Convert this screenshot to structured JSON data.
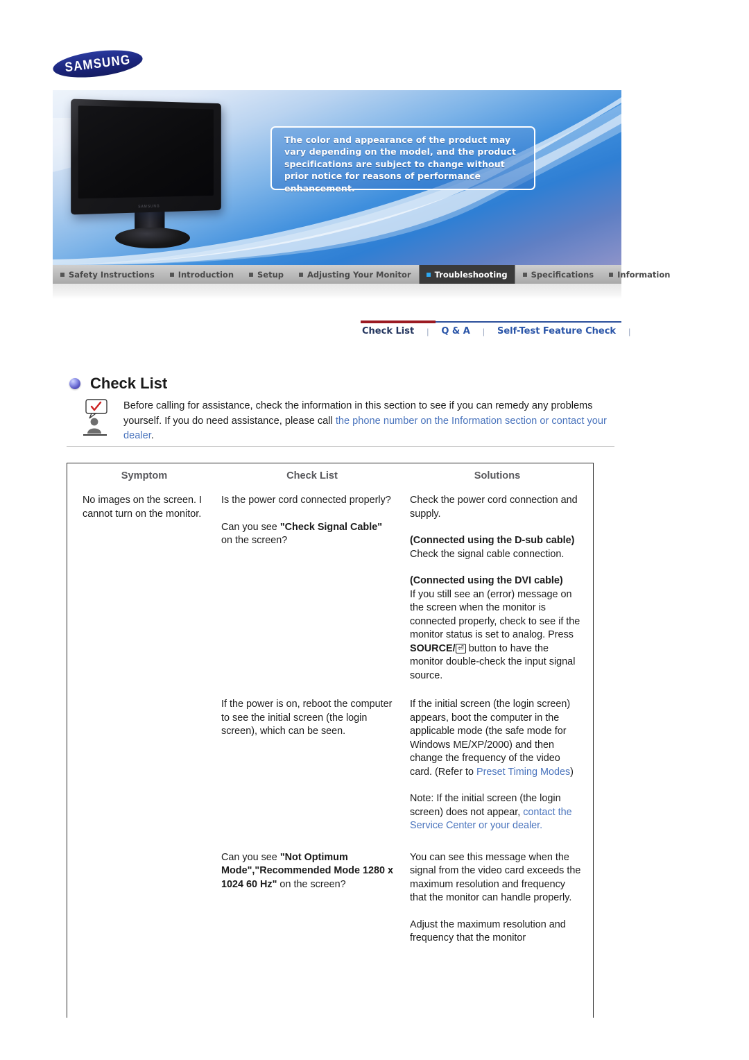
{
  "brand": {
    "logo_text": "SAMSUNG"
  },
  "hero": {
    "notice": "The color and appearance of the product may vary depending on the model, and the product specifications are subject to change without prior notice for reasons of performance enhancement.",
    "monitor_brand_label": "SAMSUNG"
  },
  "main_nav": {
    "items": [
      {
        "label": "Safety Instructions",
        "active": false
      },
      {
        "label": "Introduction",
        "active": false
      },
      {
        "label": "Setup",
        "active": false
      },
      {
        "label": "Adjusting Your Monitor",
        "active": false
      },
      {
        "label": "Troubleshooting",
        "active": true
      },
      {
        "label": "Specifications",
        "active": false
      },
      {
        "label": "Information",
        "active": false
      }
    ]
  },
  "sub_nav": {
    "items": [
      {
        "label": "Check List",
        "active": true
      },
      {
        "label": "Q & A",
        "active": false
      },
      {
        "label": "Self-Test Feature Check",
        "active": false
      }
    ],
    "separator": "|"
  },
  "section": {
    "title": "Check List",
    "intro_1": "Before calling for assistance, check the information in this section to see if you can remedy any problems yourself. If you do need assistance, please call ",
    "intro_link": "the phone number on the Information section or contact your dealer",
    "intro_end": "."
  },
  "table": {
    "headers": [
      "Symptom",
      "Check List",
      "Solutions"
    ],
    "rows": [
      {
        "symptom": "No images on the screen. I cannot turn on the monitor.",
        "checks": [
          {
            "text": "Is the power cord connected properly?"
          },
          {
            "bold": "Can you see \"Check Signal Cable\" on the screen?",
            "lead": "Can you see ",
            "strong": "\"Check Signal Cable\"",
            "tail": " on the screen?"
          }
        ],
        "solutions": [
          {
            "text": "Check the power cord connection and supply."
          },
          {
            "strong": "(Connected using the D-sub cable)",
            "tail": "Check the signal cable connection."
          },
          {
            "strong": "(Connected using the DVI cable)",
            "tail": "If you still see an (error) message on the screen when the monitor is connected properly, check to see if the monitor status is set to analog. Press ",
            "key_label": "SOURCE/",
            "key_glyph": "⏎",
            "tail2": " button to have the monitor double-check the input signal source."
          }
        ]
      },
      {
        "symptom": "",
        "checks": [
          {
            "text": "If the power is on, reboot the computer to see the initial screen (the login screen), which can be seen."
          }
        ],
        "solutions": [
          {
            "text": "If the initial screen (the login screen) appears, boot the computer in the applicable mode (the safe mode for Windows ME/XP/2000) and then change the frequency of the video card. (Refer to ",
            "link": "Preset Timing Modes",
            "tail": ")"
          },
          {
            "text": "Note: If the initial screen (the login screen) does not appear, ",
            "link2": "contact the Service Center or your dealer",
            "tail2": "."
          }
        ]
      },
      {
        "symptom": "",
        "checks": [
          {
            "lead": "Can you see ",
            "strong": "\"Not Optimum Mode\",\"Recommended Mode 1280 x 1024 60 Hz\"",
            "tail": " on the screen?"
          }
        ],
        "solutions": [
          {
            "text": "You can see this message when the signal from the video card exceeds the maximum resolution and frequency that the monitor can handle properly."
          },
          {
            "text": "Adjust the maximum resolution and frequency that the monitor"
          }
        ]
      }
    ]
  },
  "colors": {
    "accent_red": "#9b1a22",
    "accent_blue": "#2a55a8",
    "link_blue": "#4a74bd",
    "nav_active_bg": "#3a3a3a",
    "header_gray": "#58585c"
  }
}
